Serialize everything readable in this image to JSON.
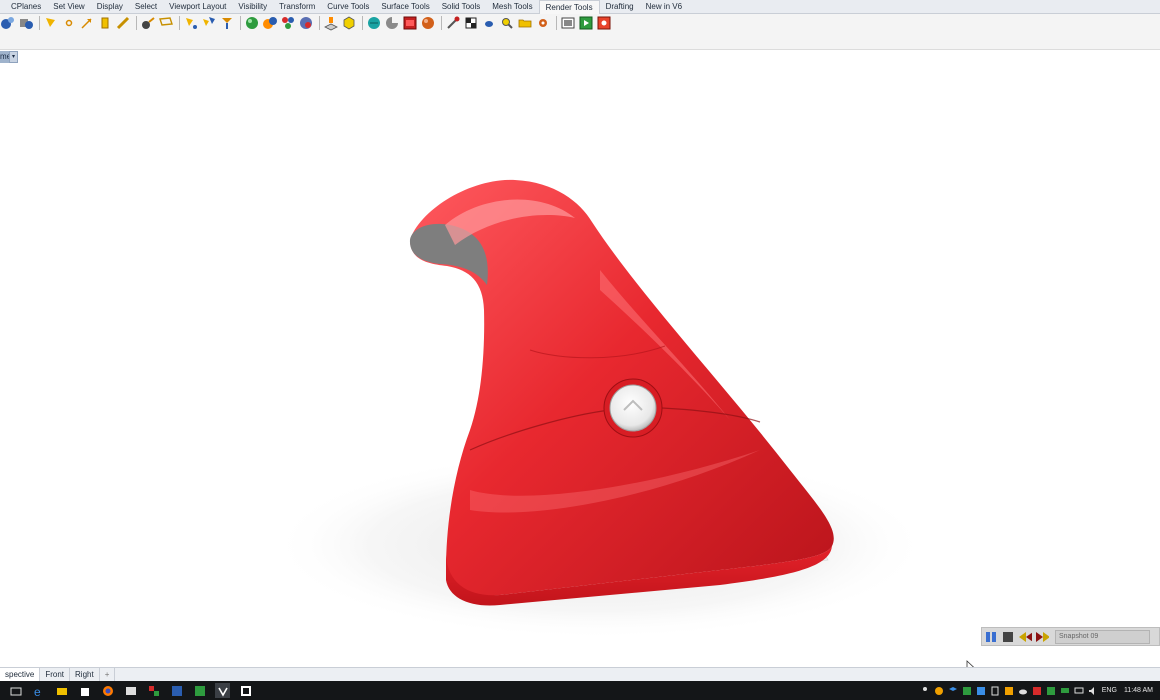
{
  "ribbon": {
    "tabs": [
      "CPlanes",
      "Set View",
      "Display",
      "Select",
      "Viewport Layout",
      "Visibility",
      "Transform",
      "Curve Tools",
      "Surface Tools",
      "Solid Tools",
      "Mesh Tools",
      "Render Tools",
      "Drafting",
      "New in V6"
    ],
    "active_tab": "Render Tools"
  },
  "viewport": {
    "name": "me",
    "model_color": "#e8282f",
    "background": "#ffffff"
  },
  "snapshot": {
    "field_text": "Snapshot 09",
    "icons": [
      "pause-icon",
      "stop-icon",
      "rewind-icon",
      "fast-forward-icon"
    ]
  },
  "view_tabs": {
    "tabs": [
      "spective",
      "Front",
      "Right"
    ],
    "add_label": "+"
  },
  "taskbar": {
    "apps": [
      "task-view-icon",
      "edge-icon",
      "file-explorer-icon",
      "store-icon",
      "firefox-icon",
      "app-icon",
      "app-icon",
      "app-icon",
      "app-icon",
      "rhino-icon",
      "app-icon"
    ],
    "language": "ENG",
    "time": "11:48 AM"
  },
  "colors": {
    "ribbon_bg": "#e9ecf1",
    "toolbar_bg": "#f4f4f4",
    "taskbar_bg": "#141618",
    "accent_red": "#e8282f"
  }
}
